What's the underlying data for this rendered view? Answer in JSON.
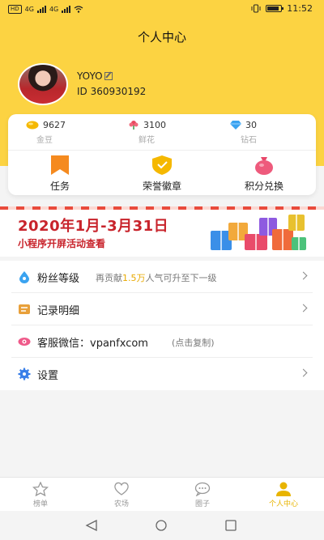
{
  "status_bar": {
    "left_tag": "HD",
    "net1": "4G",
    "net2": "4G",
    "time": "11:52"
  },
  "header": {
    "title": "个人中心"
  },
  "profile": {
    "name": "YOYO",
    "id_text": "ID 360930192"
  },
  "stats": [
    {
      "value": "9627",
      "label": "金豆",
      "icon": "gold-bean-icon",
      "color": "#f5b800"
    },
    {
      "value": "3100",
      "label": "鲜花",
      "icon": "flower-icon",
      "color": "#e84a5f"
    },
    {
      "value": "30",
      "label": "钻石",
      "icon": "diamond-icon",
      "color": "#3aa3f0"
    }
  ],
  "actions": [
    {
      "label": "任务",
      "icon": "task-bookmark-icon"
    },
    {
      "label": "荣誉徽章",
      "icon": "badge-shield-icon"
    },
    {
      "label": "积分兑换",
      "icon": "points-bag-icon"
    }
  ],
  "banner": {
    "title": "2020年1月-3月31日",
    "subtitle": "小程序开屏活动查看"
  },
  "menu": {
    "fans": {
      "label": "粉丝等级",
      "hint_prefix": "再贡献",
      "hint_highlight": "1.5万",
      "hint_suffix": "人气可升至下一级"
    },
    "records": {
      "label": "记录明细"
    },
    "wechat": {
      "label": "客服微信：vpanfxcom",
      "hint": "(点击复制)"
    },
    "settings": {
      "label": "设置"
    }
  },
  "tabs": [
    {
      "label": "榜单",
      "icon": "ranking-icon"
    },
    {
      "label": "农场",
      "icon": "farm-heart-icon"
    },
    {
      "label": "圈子",
      "icon": "circle-chat-icon"
    },
    {
      "label": "个人中心",
      "icon": "profile-icon",
      "active": true
    }
  ],
  "colors": {
    "accent": "#fcd342",
    "active_tab": "#e8b400",
    "banner_red": "#c8232b",
    "highlight": "#e8a900"
  }
}
